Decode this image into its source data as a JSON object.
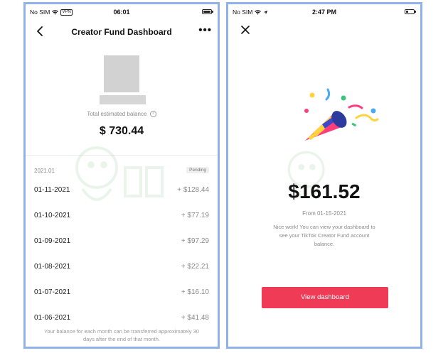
{
  "left": {
    "status": {
      "carrier": "No SIM",
      "vpn": "VPN",
      "time": "06:01",
      "battery_level": 0.95
    },
    "nav": {
      "title": "Creator Fund Dashboard"
    },
    "balance": {
      "label": "Total estimated balance",
      "value": "$ 730.44"
    },
    "period": {
      "month": "2021.01",
      "badge": "Pending"
    },
    "earnings": [
      {
        "date": "01-11-2021",
        "amount": "+ $128.44"
      },
      {
        "date": "01-10-2021",
        "amount": "+ $77.19"
      },
      {
        "date": "01-09-2021",
        "amount": "+ $97.29"
      },
      {
        "date": "01-08-2021",
        "amount": "+ $22.21"
      },
      {
        "date": "01-07-2021",
        "amount": "+ $16.10"
      },
      {
        "date": "01-06-2021",
        "amount": "+ $41.48"
      }
    ],
    "footnote": "Your balance for each month can be transferred approximately 30 days after the end of that month."
  },
  "right": {
    "status": {
      "carrier": "No SIM",
      "time": "2:47 PM",
      "battery_level": 0.25
    },
    "amount": "$161.52",
    "from": "From 01-15-2021",
    "message": "Nice work! You can view your dashboard to see your TikTok Creator Fund account balance.",
    "button": "View dashboard"
  },
  "colors": {
    "accent": "#ef3b56",
    "frame": "#8fb2ec"
  }
}
